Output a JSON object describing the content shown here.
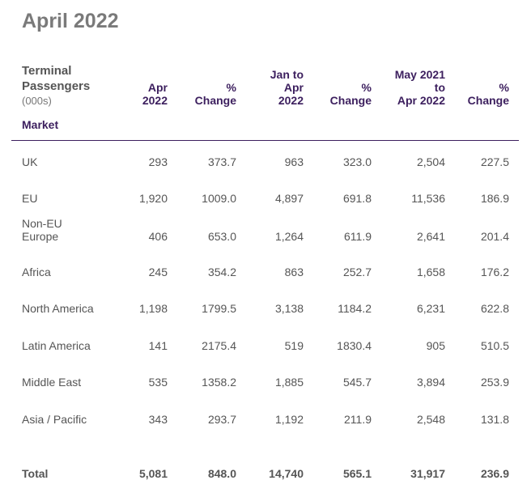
{
  "title": "April 2022",
  "header": {
    "label_line1": "Terminal",
    "label_line2": "Passengers",
    "unit": "(000s)",
    "market": "Market",
    "columns": [
      {
        "line1": "",
        "line2": "Apr",
        "line3": "2022"
      },
      {
        "line1": "",
        "line2": "%",
        "line3": "Change"
      },
      {
        "line1": "Jan to",
        "line2": "Apr",
        "line3": "2022"
      },
      {
        "line1": "",
        "line2": "%",
        "line3": "Change"
      },
      {
        "line1": "May 2021",
        "line2": "to",
        "line3": "Apr 2022"
      },
      {
        "line1": "",
        "line2": "%",
        "line3": "Change"
      }
    ]
  },
  "rows": [
    {
      "market": "UK",
      "values": [
        "293",
        "373.7",
        "963",
        "323.0",
        "2,504",
        "227.5"
      ]
    },
    {
      "market": "EU",
      "values": [
        "1,920",
        "1009.0",
        "4,897",
        "691.8",
        "11,536",
        "186.9"
      ]
    },
    {
      "market_line1": "Non-EU",
      "market_line2": "Europe",
      "values": [
        "406",
        "653.0",
        "1,264",
        "611.9",
        "2,641",
        "201.4"
      ]
    },
    {
      "market": "Africa",
      "values": [
        "245",
        "354.2",
        "863",
        "252.7",
        "1,658",
        "176.2"
      ]
    },
    {
      "market": "North America",
      "values": [
        "1,198",
        "1799.5",
        "3,138",
        "1184.2",
        "6,231",
        "622.8"
      ]
    },
    {
      "market": "Latin America",
      "values": [
        "141",
        "2175.4",
        "519",
        "1830.4",
        "905",
        "510.5"
      ]
    },
    {
      "market": "Middle East",
      "values": [
        "535",
        "1358.2",
        "1,885",
        "545.7",
        "3,894",
        "253.9"
      ]
    },
    {
      "market": "Asia / Pacific",
      "values": [
        "343",
        "293.7",
        "1,192",
        "211.9",
        "2,548",
        "131.8"
      ]
    }
  ],
  "total": {
    "market": "Total",
    "values": [
      "5,081",
      "848.0",
      "14,740",
      "565.1",
      "31,917",
      "236.9"
    ]
  }
}
